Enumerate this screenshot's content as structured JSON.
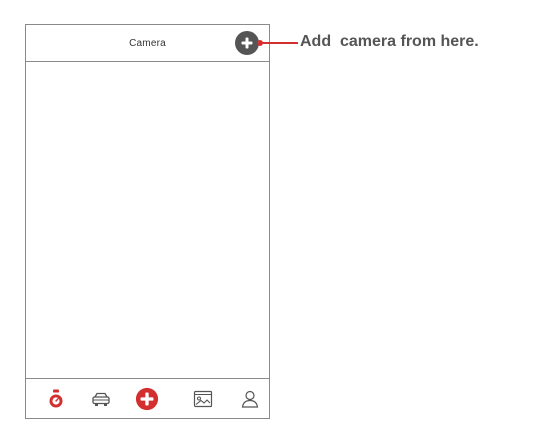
{
  "header": {
    "title": "Camera",
    "add_icon": "plus-circle-icon"
  },
  "tabbar": {
    "items": [
      {
        "icon": "timer-icon",
        "active": true
      },
      {
        "icon": "car-icon",
        "active": false
      },
      {
        "icon": "plus-circle-icon",
        "active": false
      },
      {
        "icon": "gallery-icon",
        "active": false
      },
      {
        "icon": "user-icon",
        "active": false
      }
    ]
  },
  "annotation": {
    "text": "Add  camera from here."
  },
  "colors": {
    "accent": "#d32f2f",
    "header_button": "#555555",
    "border": "#8a8a8a",
    "icon": "#555555"
  }
}
